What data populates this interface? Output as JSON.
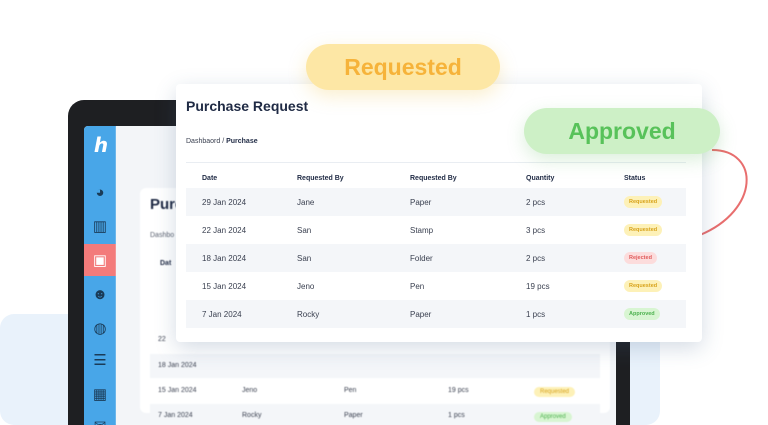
{
  "colors": {
    "sidebar": "#48a6e8",
    "sidebar_active": "#f37b7b",
    "requested_bg": "#fdf1b8",
    "requested_text": "#d7a21a",
    "rejected_bg": "#fcdcdc",
    "rejected_text": "#e05b5b",
    "approved_bg": "#d8f5d2",
    "approved_text": "#4cb14e",
    "curve": "#e86e6e"
  },
  "tablet": {
    "logo": "h",
    "sidebar_icons": [
      "pie-chart-icon",
      "bar-chart-icon",
      "shopping-bag-icon",
      "users-icon",
      "globe-icon",
      "database-icon",
      "calculator-icon",
      "mail-icon"
    ],
    "title": "Purc",
    "breadcrumb": "Dashbo",
    "header_fragment": "Dat",
    "rows": [
      {
        "date": "22",
        "by": "",
        "item": "",
        "qty": "",
        "status": ""
      },
      {
        "date": "18 Jan 2024",
        "by": "",
        "item": "",
        "qty": "",
        "status": ""
      },
      {
        "date": "15 Jan 2024",
        "by": "Jeno",
        "item": "Pen",
        "qty": "19 pcs",
        "status": "Requested"
      },
      {
        "date": "7 Jan 2024",
        "by": "Rocky",
        "item": "Paper",
        "qty": "1 pcs",
        "status": "Approved"
      }
    ]
  },
  "card": {
    "title": "Purchase Request",
    "breadcrumb_parent": "Dashbaord",
    "breadcrumb_sep": " / ",
    "breadcrumb_current": "Purchase",
    "columns": [
      "Date",
      "Requested By",
      "Requested By",
      "Quantity",
      "Status"
    ],
    "rows": [
      {
        "date": "29 Jan 2024",
        "by": "Jane",
        "item": "Paper",
        "qty": "2 pcs",
        "status": "Requested"
      },
      {
        "date": "22 Jan 2024",
        "by": "San",
        "item": "Stamp",
        "qty": "3 pcs",
        "status": "Requested"
      },
      {
        "date": "18 Jan 2024",
        "by": "San",
        "item": "Folder",
        "qty": "2 pcs",
        "status": "Rejected"
      },
      {
        "date": "15 Jan 2024",
        "by": "Jeno",
        "item": "Pen",
        "qty": "19 pcs",
        "status": "Requested"
      },
      {
        "date": "7 Jan 2024",
        "by": "Rocky",
        "item": "Paper",
        "qty": "1 pcs",
        "status": "Approved"
      }
    ]
  },
  "pills": {
    "requested": "Requested",
    "approved": "Approved"
  }
}
